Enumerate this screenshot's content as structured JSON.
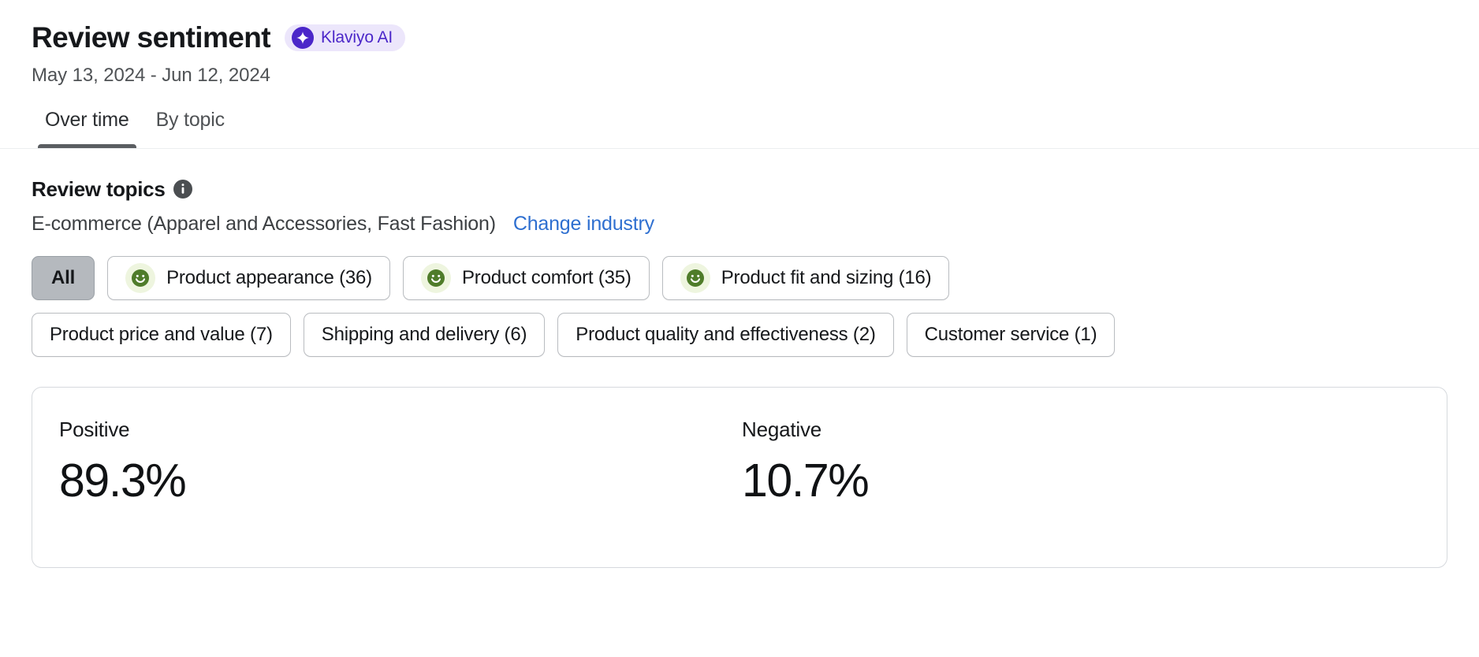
{
  "header": {
    "title": "Review sentiment",
    "ai_badge": {
      "label": "Klaviyo AI",
      "icon": "sparkle-icon",
      "bg_color": "#ece6fb",
      "accent_color": "#4b27c9"
    },
    "date_range": "May 13, 2024 - Jun 12, 2024"
  },
  "tabs": [
    {
      "label": "Over time",
      "active": true
    },
    {
      "label": "By topic",
      "active": false
    }
  ],
  "review_topics": {
    "heading": "Review topics",
    "info_icon": "info-icon",
    "industry": "E-commerce (Apparel and Accessories, Fast Fashion)",
    "change_industry_link": "Change industry",
    "chips_row_1": [
      {
        "label": "All",
        "selected": true,
        "has_sentiment_icon": false
      },
      {
        "label": "Product appearance (36)",
        "selected": false,
        "has_sentiment_icon": true,
        "icon": "smiley-positive-icon"
      },
      {
        "label": "Product comfort (35)",
        "selected": false,
        "has_sentiment_icon": true,
        "icon": "smiley-positive-icon"
      },
      {
        "label": "Product fit and sizing (16)",
        "selected": false,
        "has_sentiment_icon": true,
        "icon": "smiley-positive-icon"
      }
    ],
    "chips_row_2": [
      {
        "label": "Product price and value (7)",
        "selected": false,
        "has_sentiment_icon": false
      },
      {
        "label": "Shipping and delivery (6)",
        "selected": false,
        "has_sentiment_icon": false
      },
      {
        "label": "Product quality and effectiveness (2)",
        "selected": false,
        "has_sentiment_icon": false
      },
      {
        "label": "Customer service (1)",
        "selected": false,
        "has_sentiment_icon": false
      }
    ]
  },
  "sentiment_card": {
    "positive": {
      "label": "Positive",
      "value": "89.3%"
    },
    "negative": {
      "label": "Negative",
      "value": "10.7%"
    }
  },
  "colors": {
    "smiley_green": "#4f7c2a",
    "smiley_halo": "#eef5df",
    "link_blue": "#2e6fd0",
    "tab_underline": "#5a5d61",
    "chip_border": "#b9bcc0",
    "chip_selected_bg": "#b5b9be"
  }
}
